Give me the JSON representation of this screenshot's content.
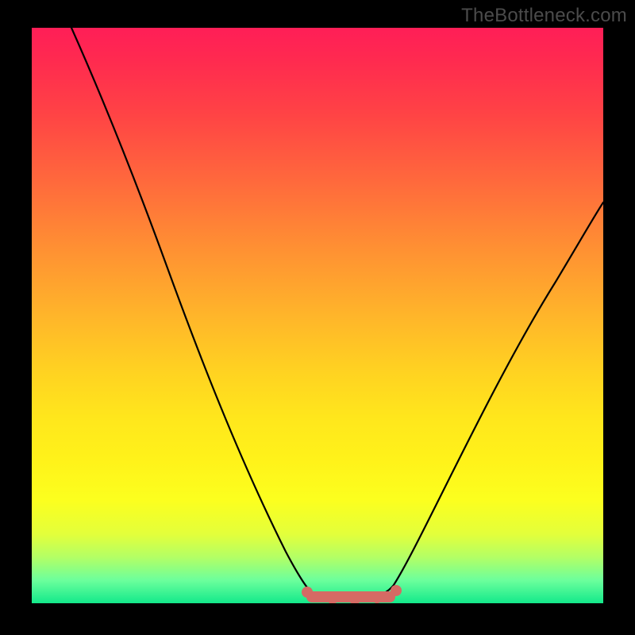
{
  "watermark": "TheBottleneck.com",
  "chart_data": {
    "type": "line",
    "title": "",
    "xlabel": "",
    "ylabel": "",
    "xlim": [
      0,
      100
    ],
    "ylim": [
      0,
      100
    ],
    "series": [
      {
        "name": "curve",
        "x": [
          7,
          12,
          18,
          25,
          32,
          40,
          48,
          50,
          52,
          54,
          56,
          58,
          60,
          62,
          64,
          68,
          74,
          80,
          86,
          92,
          100
        ],
        "y": [
          100,
          88,
          74,
          58,
          42,
          24,
          6,
          2,
          0.5,
          0.2,
          0.1,
          0.2,
          0.5,
          2,
          5,
          14,
          28,
          42,
          54,
          64,
          74
        ]
      }
    ],
    "highlight_band": {
      "x_start": 48,
      "x_end": 64,
      "y": 0.5
    },
    "background_gradient": {
      "top": "#ff1e57",
      "bottom": "#13e98b"
    }
  }
}
